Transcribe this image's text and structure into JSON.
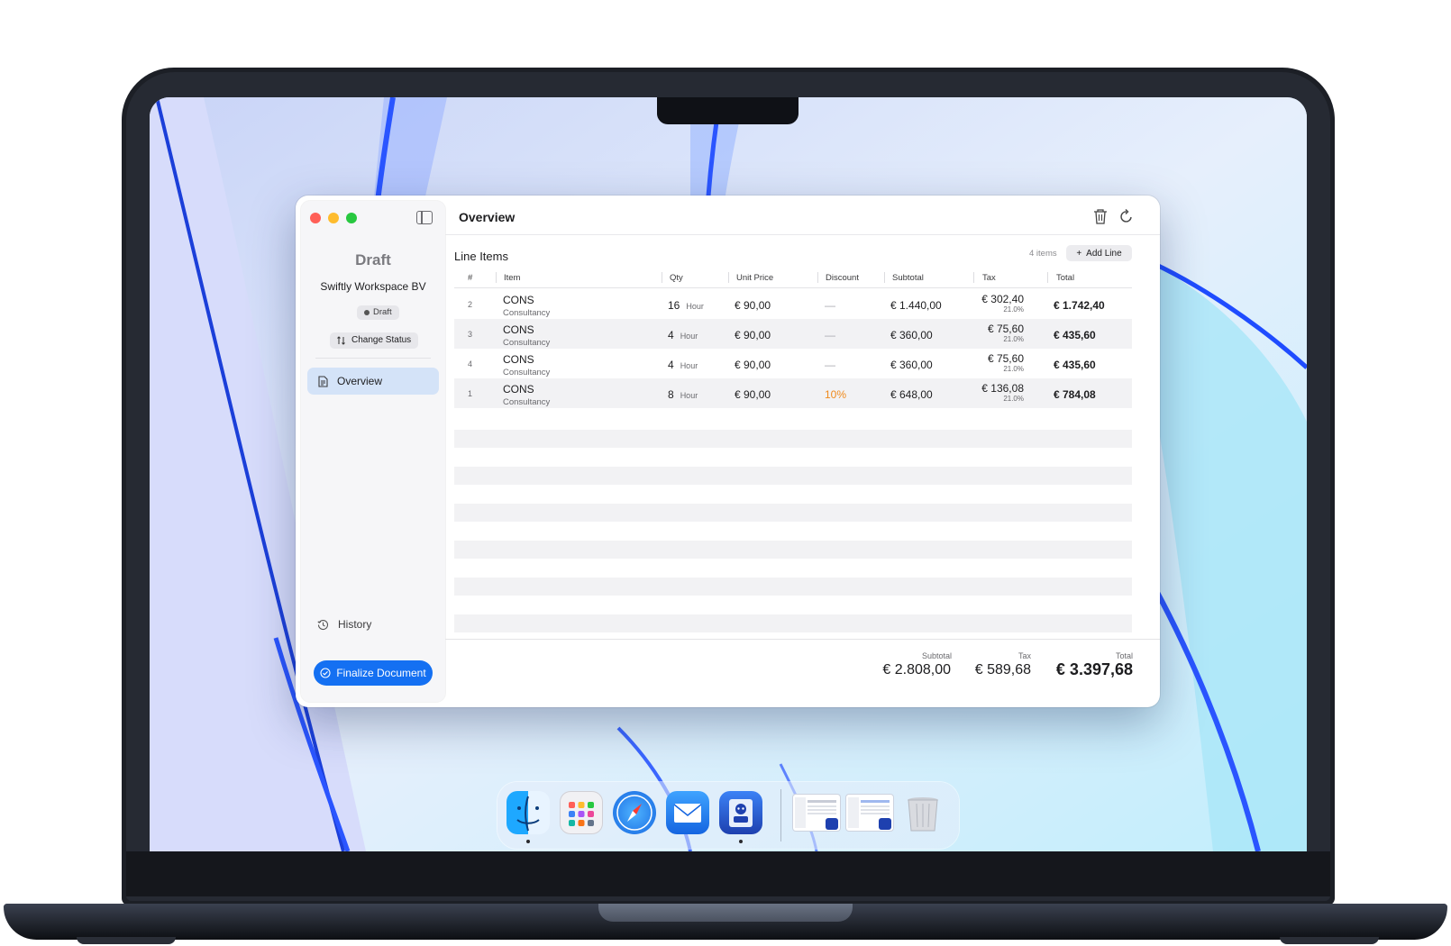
{
  "colors": {
    "accent": "#1470f2",
    "discount": "#f08a1c",
    "selected": "#d4e3f8"
  },
  "sidebar": {
    "title": "Draft",
    "company": "Swiftly Workspace BV",
    "status_badge": "Draft",
    "change_status": "Change Status",
    "nav": [
      {
        "label": "Overview",
        "icon": "document-icon",
        "selected": true
      }
    ],
    "history": "History",
    "finalize": "Finalize Document"
  },
  "main": {
    "title": "Overview",
    "section_title": "Line Items",
    "item_count": "4 items",
    "add_line": "Add Line",
    "columns": [
      "#",
      "Item",
      "Qty",
      "Unit Price",
      "Discount",
      "Subtotal",
      "Tax",
      "Total"
    ],
    "rows": [
      {
        "num": "2",
        "item": "CONS",
        "desc": "Consultancy",
        "qty": "16",
        "unit": "Hour",
        "unit_price": "€ 90,00",
        "discount": "—",
        "subtotal": "€ 1.440,00",
        "tax": "€ 302,40",
        "tax_rate": "21.0%",
        "total": "€ 1.742,40"
      },
      {
        "num": "3",
        "item": "CONS",
        "desc": "Consultancy",
        "qty": "4",
        "unit": "Hour",
        "unit_price": "€ 90,00",
        "discount": "—",
        "subtotal": "€ 360,00",
        "tax": "€ 75,60",
        "tax_rate": "21.0%",
        "total": "€ 435,60"
      },
      {
        "num": "4",
        "item": "CONS",
        "desc": "Consultancy",
        "qty": "4",
        "unit": "Hour",
        "unit_price": "€ 90,00",
        "discount": "—",
        "subtotal": "€ 360,00",
        "tax": "€ 75,60",
        "tax_rate": "21.0%",
        "total": "€ 435,60"
      },
      {
        "num": "1",
        "item": "CONS",
        "desc": "Consultancy",
        "qty": "8",
        "unit": "Hour",
        "unit_price": "€ 90,00",
        "discount": "10%",
        "subtotal": "€ 648,00",
        "tax": "€ 136,08",
        "tax_rate": "21.0%",
        "total": "€ 784,08"
      }
    ],
    "totals": {
      "subtotal_label": "Subtotal",
      "subtotal": "€ 2.808,00",
      "tax_label": "Tax",
      "tax": "€ 589,68",
      "total_label": "Total",
      "total": "€ 3.397,68"
    }
  },
  "dock": {
    "apps": [
      "finder-icon",
      "launchpad-icon",
      "safari-icon",
      "mail-icon",
      "invoice-app-icon"
    ],
    "minimized": [
      "window-thumbnail-1",
      "window-thumbnail-2"
    ],
    "trash": "trash-icon"
  }
}
